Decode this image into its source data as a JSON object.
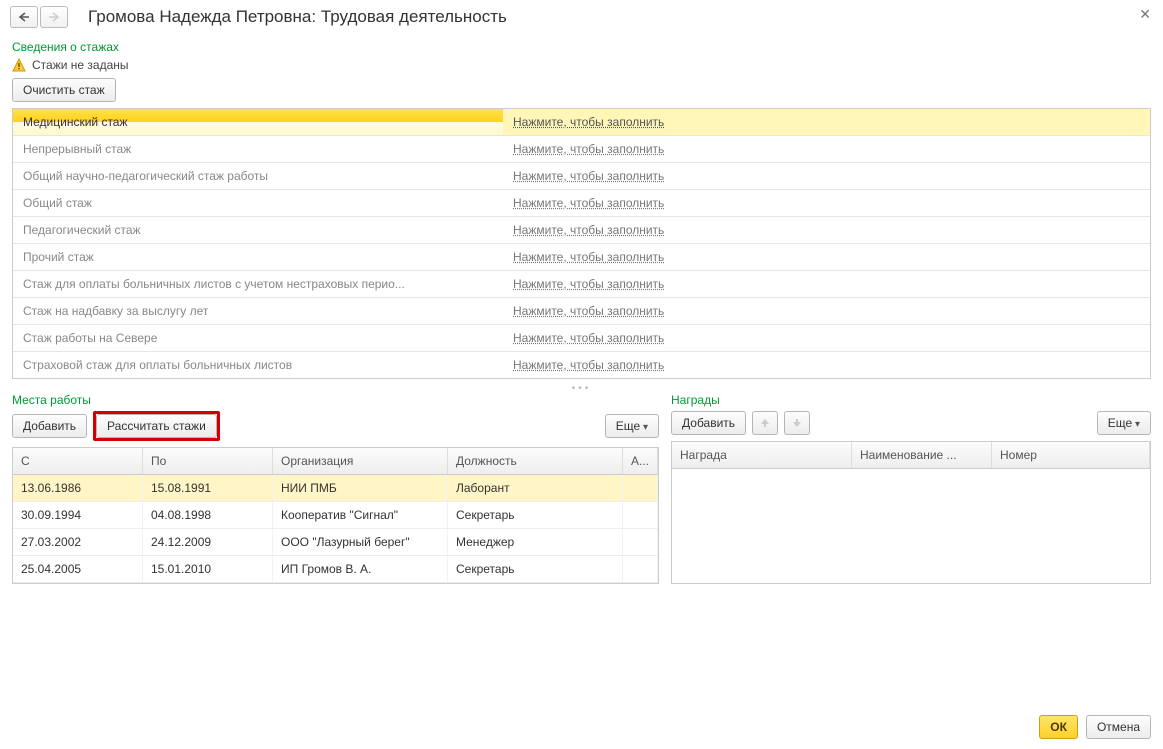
{
  "header": {
    "title": "Громова Надежда Петровна: Трудовая деятельность"
  },
  "stazh_section": {
    "label": "Сведения о стажах",
    "warning": "Стажи не заданы",
    "clear_btn": "Очистить стаж",
    "fill_link": "Нажмите, чтобы заполнить",
    "rows": [
      {
        "label": "Медицинский стаж",
        "selected": true
      },
      {
        "label": "Непрерывный стаж"
      },
      {
        "label": "Общий научно-педагогический стаж работы"
      },
      {
        "label": "Общий стаж"
      },
      {
        "label": "Педагогический стаж"
      },
      {
        "label": "Прочий стаж"
      },
      {
        "label": "Стаж для оплаты больничных листов с учетом нестраховых перио..."
      },
      {
        "label": "Стаж на надбавку за выслугу лет"
      },
      {
        "label": "Стаж работы на Севере"
      },
      {
        "label": "Страховой стаж для оплаты больничных листов"
      }
    ]
  },
  "jobs_section": {
    "label": "Места работы",
    "add_btn": "Добавить",
    "calc_btn": "Рассчитать стажи",
    "more_btn": "Еще",
    "columns": {
      "s": "С",
      "po": "По",
      "org": "Организация",
      "pos": "Должность",
      "a": "А..."
    },
    "rows": [
      {
        "s": "13.06.1986",
        "po": "15.08.1991",
        "org": "НИИ ПМБ",
        "pos": "Лаборант",
        "selected": true
      },
      {
        "s": "30.09.1994",
        "po": "04.08.1998",
        "org": "Кооператив \"Сигнал\"",
        "pos": "Секретарь"
      },
      {
        "s": "27.03.2002",
        "po": "24.12.2009",
        "org": "ООО \"Лазурный берег\"",
        "pos": "Менеджер"
      },
      {
        "s": "25.04.2005",
        "po": "15.01.2010",
        "org": "ИП Громов В. А.",
        "pos": "Секретарь"
      }
    ]
  },
  "awards_section": {
    "label": "Награды",
    "add_btn": "Добавить",
    "more_btn": "Еще",
    "columns": {
      "n": "Награда",
      "name": "Наименование ...",
      "num": "Номер"
    },
    "rows": []
  },
  "footer": {
    "ok": "ОК",
    "cancel": "Отмена"
  }
}
